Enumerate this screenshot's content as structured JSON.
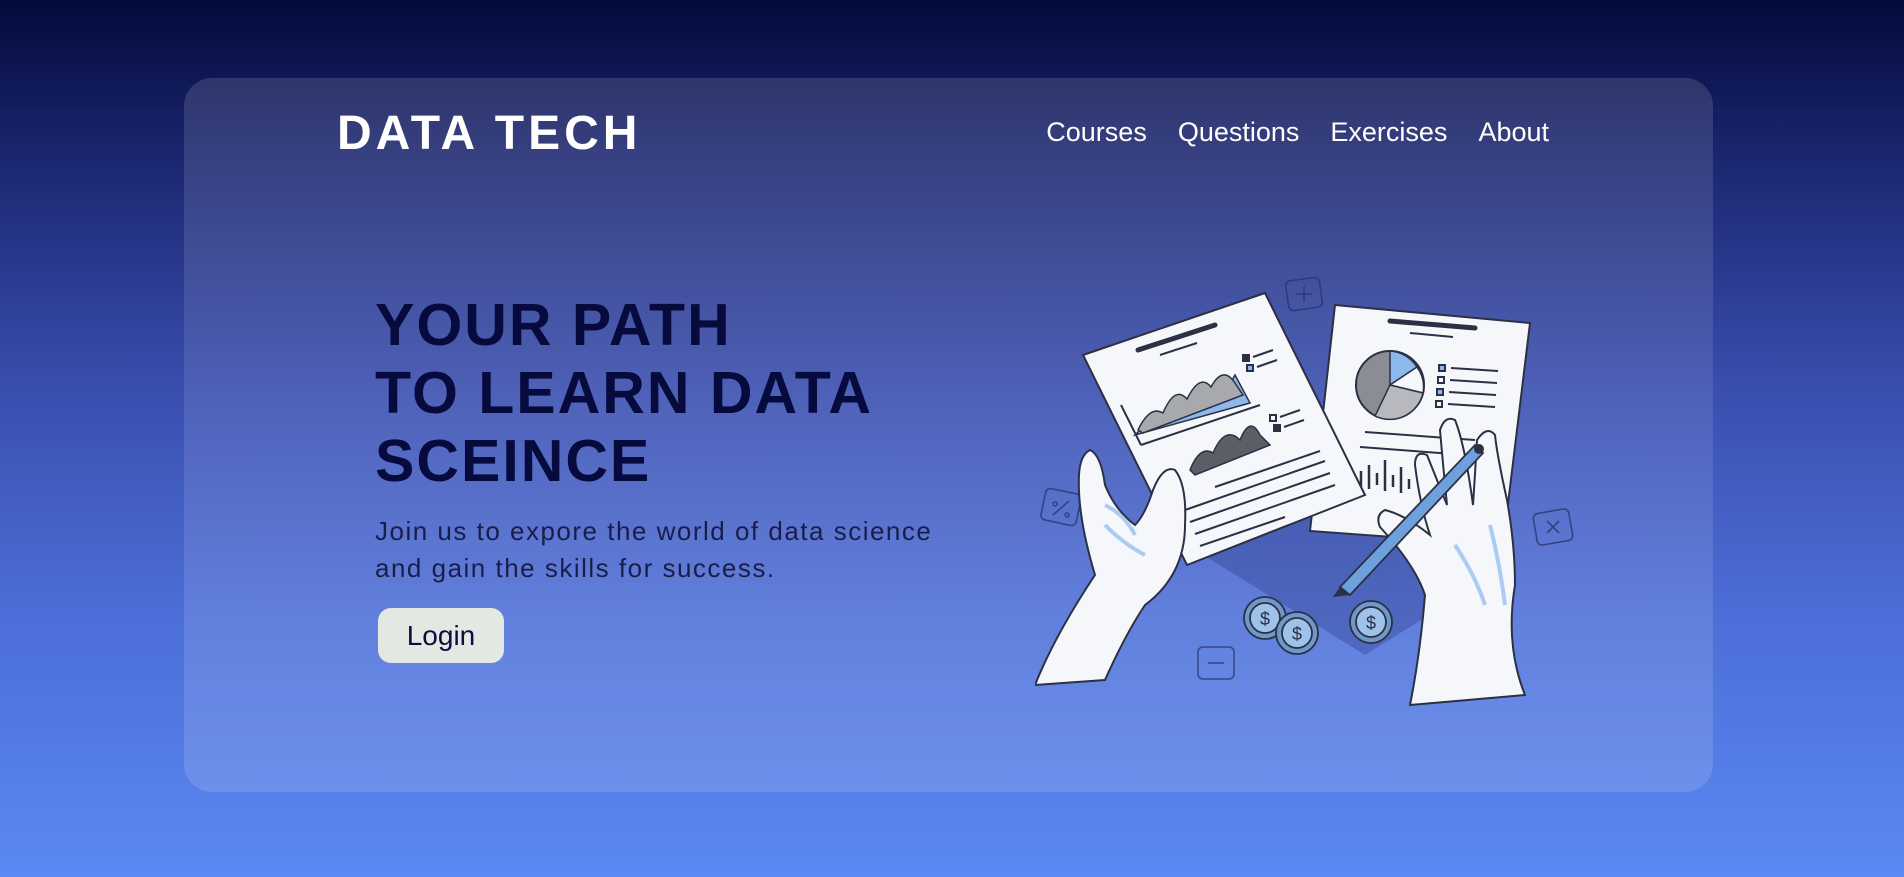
{
  "brand": {
    "logo": "DATA TECH"
  },
  "nav": {
    "items": [
      {
        "label": "Courses"
      },
      {
        "label": "Questions"
      },
      {
        "label": "Exercises"
      },
      {
        "label": "About"
      }
    ]
  },
  "hero": {
    "title_lines": [
      "YOUR PATH",
      "TO LEARN DATA",
      "SCEINCE"
    ],
    "subtitle_lines": [
      "Join us to expore the world of data science",
      "and gain the skills for success."
    ],
    "login_label": "Login"
  },
  "colors": {
    "background_top": "#030a3a",
    "background_bottom": "#5b88f2",
    "title": "#060a3d",
    "button_bg": "#e4e8e3",
    "accent": "#8cb8ec"
  },
  "illustration": {
    "icon": "hands-holding-data-reports-icon"
  }
}
